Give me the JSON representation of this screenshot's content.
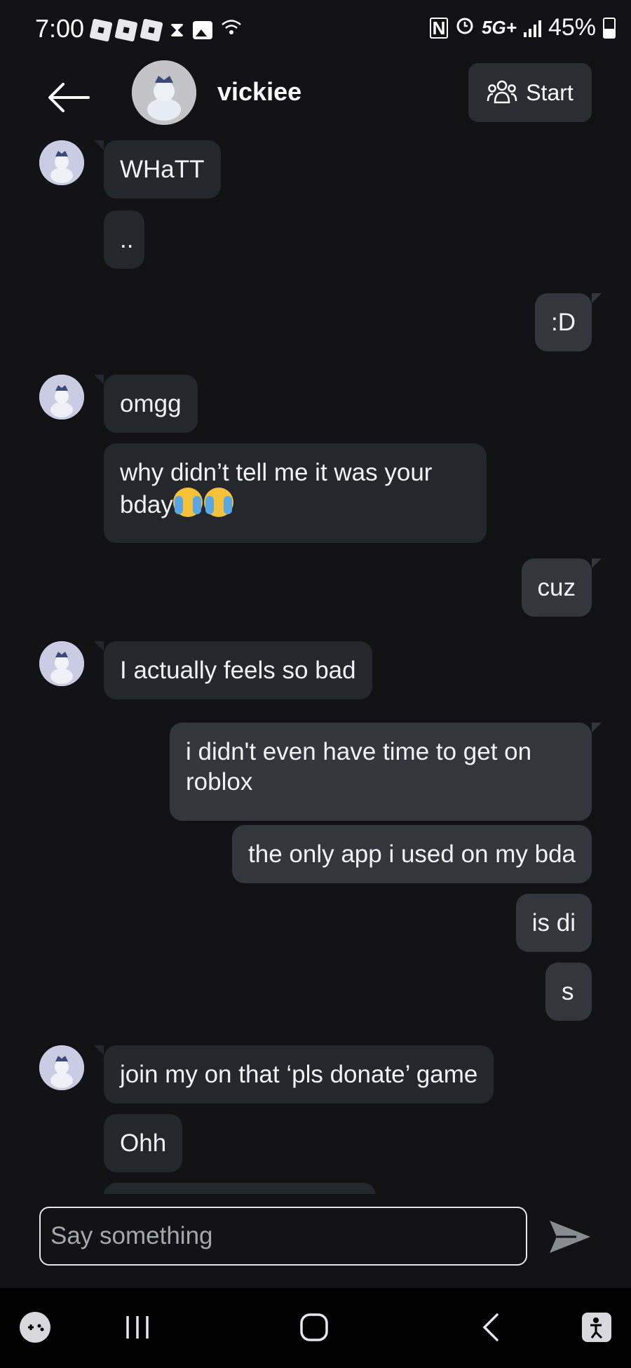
{
  "status_bar": {
    "time": "7:00",
    "network": "5G+",
    "battery": "45%"
  },
  "header": {
    "contact_name": "vickiee",
    "start_label": "Start"
  },
  "messages": [
    {
      "sender": "vickiee",
      "text": "WHaTT"
    },
    {
      "sender": "vickiee",
      "text": ".."
    },
    {
      "sender": "me",
      "text": ":D"
    },
    {
      "sender": "vickiee",
      "text": "omgg"
    },
    {
      "sender": "vickiee",
      "text": "why didn’t tell me it was your bday"
    },
    {
      "sender": "me",
      "text": "cuz"
    },
    {
      "sender": "vickiee",
      "text": "I actually feels so bad"
    },
    {
      "sender": "me",
      "text": "i didn't even have time to get on roblox"
    },
    {
      "sender": "me",
      "text": "the only app i used on my bda"
    },
    {
      "sender": "me",
      "text": "is di"
    },
    {
      "sender": "me",
      "text": "s"
    },
    {
      "sender": "vickiee",
      "text": "join my on that ‘pls donate’ game"
    },
    {
      "sender": "vickiee",
      "text": "Ohh"
    }
  ],
  "composer": {
    "placeholder": "Say something"
  },
  "icons": {
    "back": "arrow-left-icon",
    "start": "group-icon",
    "send": "send-icon"
  }
}
